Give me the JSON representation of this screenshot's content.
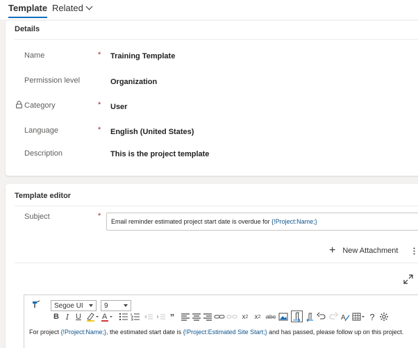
{
  "tabs": {
    "template": "Template",
    "related": "Related"
  },
  "details": {
    "title": "Details",
    "fields": [
      {
        "label": "Name",
        "value": "Training Template",
        "required": "*"
      },
      {
        "label": "Permission level",
        "value": "Organization",
        "required": ""
      },
      {
        "label": "Category",
        "value": "User",
        "required": "*"
      },
      {
        "label": "Language",
        "value": "English (United States)",
        "required": "*"
      },
      {
        "label": "Description",
        "value": "This is the project template",
        "required": ""
      }
    ]
  },
  "editor_section": {
    "title": "Template editor",
    "subject_label": "Subject",
    "subject_required": "*",
    "subject_prefix": "Email reminder estimated project start date is overdue for ",
    "subject_token": "{!Project:Name;}",
    "new_attachment": "New Attachment"
  },
  "editor": {
    "font_name": "Segoe UI",
    "font_size": "9",
    "body_prefix": "For project ",
    "body_token1": "{!Project:Name;}",
    "body_mid": ", the estimated start date is ",
    "body_token2": "{!Project:Estimated Site Start;}",
    "body_suffix": " and has passed, please follow up on this project."
  },
  "colors": {
    "accent": "#0f6cbd",
    "required": "#a4262c",
    "token": "#0f548c"
  }
}
